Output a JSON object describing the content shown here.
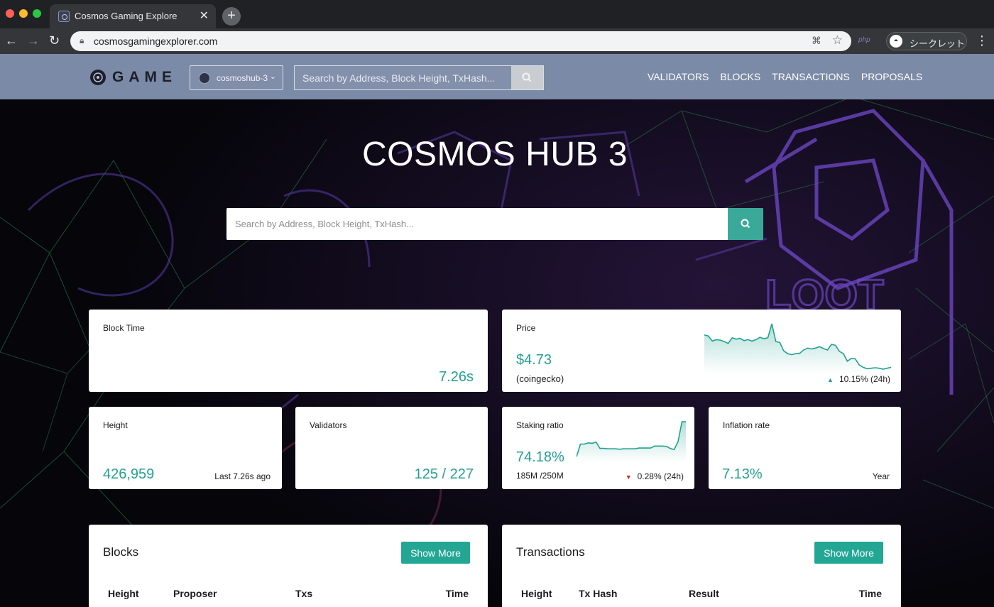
{
  "browser": {
    "tab_title": "Cosmos Gaming Explore",
    "url": "cosmosgamingexplorer.com",
    "extension_label": "php",
    "incognito_label": "シークレット"
  },
  "nav": {
    "logo_text": "GAME",
    "chain_name": "cosmoshub-3",
    "search_placeholder": "Search by Address, Block Height, TxHash...",
    "links": [
      "VALIDATORS",
      "BLOCKS",
      "TRANSACTIONS",
      "PROPOSALS"
    ]
  },
  "hero": {
    "title": "COSMOS HUB 3",
    "search_placeholder": "Search by Address, Block Height, TxHash..."
  },
  "stats": {
    "block_time": {
      "label": "Block Time",
      "value": "7.26s"
    },
    "price": {
      "label": "Price",
      "value": "$4.73",
      "source": "(coingecko)",
      "change": "10.15% (24h)",
      "change_direction": "up",
      "sparkline": [
        76,
        74,
        63,
        66,
        65,
        62,
        58,
        70,
        67,
        69,
        64,
        66,
        63,
        66,
        71,
        68,
        70,
        100,
        62,
        60,
        42,
        36,
        34,
        36,
        37,
        44,
        48,
        46,
        48,
        51,
        47,
        44,
        56,
        54,
        41,
        36,
        20,
        26,
        25,
        12,
        7,
        4,
        5,
        6,
        5,
        3,
        5,
        7
      ]
    },
    "height": {
      "label": "Height",
      "value": "426,959",
      "sub": "Last 7.26s ago"
    },
    "validators": {
      "label": "Validators",
      "value": "125 / 227"
    },
    "staking": {
      "label": "Staking ratio",
      "value": "74.18%",
      "sub": "185M /250M",
      "change": "0.28% (24h)",
      "change_direction": "down",
      "sparkline": [
        10,
        42,
        42,
        45,
        44,
        47,
        31,
        31,
        30,
        30,
        30,
        29,
        30,
        30,
        30,
        30,
        32,
        32,
        32,
        32,
        37,
        37,
        37,
        36,
        31,
        28,
        48,
        98,
        98
      ]
    },
    "inflation": {
      "label": "Inflation rate",
      "value": "7.13%",
      "sub": "Year"
    }
  },
  "blocks_panel": {
    "title": "Blocks",
    "button": "Show More",
    "columns": [
      "Height",
      "Proposer",
      "Txs",
      "Time"
    ]
  },
  "transactions_panel": {
    "title": "Transactions",
    "button": "Show More",
    "columns": [
      "Height",
      "Tx Hash",
      "Result",
      "Time"
    ]
  },
  "colors": {
    "accent": "#22a18f",
    "nav_bg": "#7b8aa6",
    "positive": "#22a18f",
    "negative": "#e02424"
  }
}
